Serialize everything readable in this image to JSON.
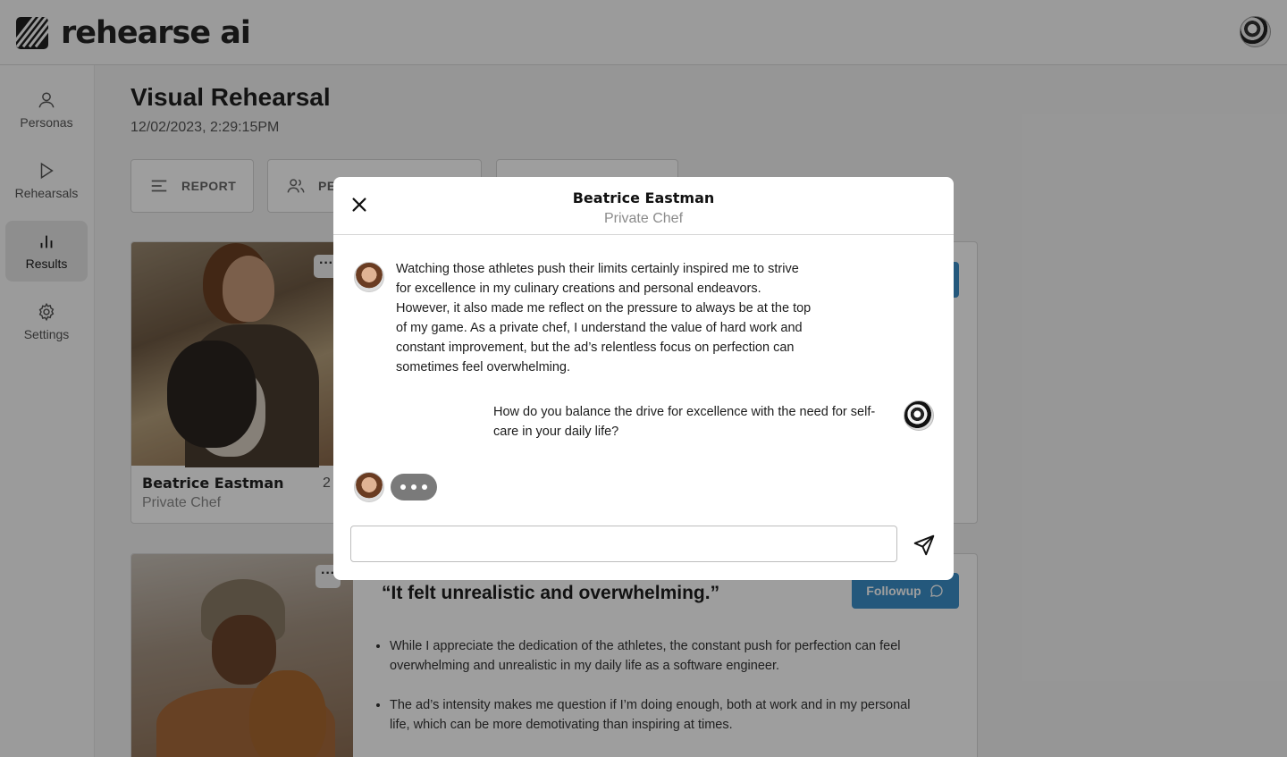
{
  "app": {
    "name": "rehearse ai"
  },
  "sidebar": {
    "items": [
      {
        "label": "Personas",
        "icon": "user-icon"
      },
      {
        "label": "Rehearsals",
        "icon": "play-icon"
      },
      {
        "label": "Results",
        "icon": "bar-chart-icon",
        "active": true
      },
      {
        "label": "Settings",
        "icon": "gear-icon"
      }
    ]
  },
  "page": {
    "title": "Visual Rehearsal",
    "date": "12/02/2023, 2:29:15PM"
  },
  "toolbar": {
    "report_label": "REPORT",
    "personas_label_partial": "PE"
  },
  "cards": [
    {
      "name": "Beatrice Eastman",
      "role": "Private Chef",
      "number_partial": "2"
    },
    {
      "quote": "“It felt unrealistic and overwhelming.”",
      "followup_label": "Followup",
      "bullets": [
        "While I appreciate the dedication of the athletes, the constant push for perfection can feel overwhelming and unrealistic in my daily life as a software engineer.",
        "The ad’s intensity makes me question if I’m doing enough, both at work and in my personal life, which can be more demotivating than inspiring at times."
      ]
    }
  ],
  "modal": {
    "name": "Beatrice Eastman",
    "role": "Private Chef",
    "messages": [
      {
        "sender": "persona",
        "text": "Watching those athletes push their limits certainly inspired me to strive for excellence in my culinary creations and personal endeavors. However, it also made me reflect on the pressure to always be at the top of my game. As a private chef, I understand the value of hard work and constant improvement, but the ad’s relentless focus on perfection can sometimes feel overwhelming."
      },
      {
        "sender": "user",
        "text": "How do you balance the drive for excellence with the need for self-care in your daily life?"
      }
    ],
    "typing": true,
    "input_value": "",
    "input_placeholder": ""
  },
  "colors": {
    "accent": "#3a8ec9",
    "typing_bubble": "#7a7a7a",
    "overlay": "rgba(0,0,0,0.38)"
  }
}
